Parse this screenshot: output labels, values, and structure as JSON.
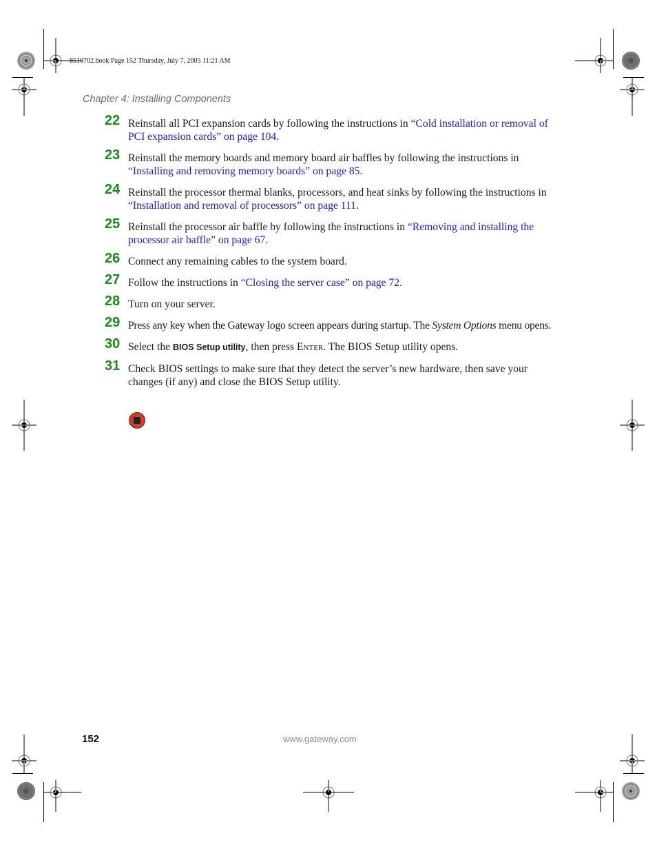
{
  "slug": "8510702.book  Page 152  Thursday, July 7, 2005  11:21 AM",
  "header": {
    "chapter": "Chapter 4: Installing Components"
  },
  "colors": {
    "step_number": "#1a8a1a",
    "link": "#1a1ad6",
    "stop_icon": "#d63a2a"
  },
  "steps": [
    {
      "num": "22",
      "pre": "Reinstall all PCI expansion cards by following the instructions in ",
      "link": "“Cold installation or removal of PCI expansion cards” on page 104",
      "post": "."
    },
    {
      "num": "23",
      "pre": "Reinstall the memory boards and memory board air baffles by following the instructions in ",
      "link": "“Installing and removing memory boards” on page 85",
      "post": "."
    },
    {
      "num": "24",
      "pre": "Reinstall the processor thermal blanks, processors, and heat sinks by following the instructions in ",
      "link": "“Installation and removal of processors” on page 111",
      "post": "."
    },
    {
      "num": "25",
      "pre": "Reinstall the processor air baffle by following the instructions in ",
      "link": "“Removing and installing the processor air baffle” on page 67",
      "post": "."
    },
    {
      "num": "26",
      "text": "Connect any remaining cables to the system board."
    },
    {
      "num": "27",
      "pre": "Follow the instructions in ",
      "link": "“Closing the server case” on page 72",
      "post": "."
    },
    {
      "num": "28",
      "text": "Turn on your server."
    },
    {
      "num": "29",
      "pre": "Press any key when the Gateway logo screen appears during startup. The ",
      "italic": "System Options",
      "post": " menu opens."
    },
    {
      "num": "30",
      "pre": "Select the ",
      "bold": "BIOS Setup utility",
      "mid": ", then press ",
      "key": "Enter",
      "post": ". The BIOS Setup utility opens."
    },
    {
      "num": "31",
      "text": "Check BIOS settings to make sure that they detect the server’s new hardware, then save your changes (if any) and close the BIOS Setup utility."
    }
  ],
  "footer": {
    "page_number": "152",
    "website": "www.gateway.com"
  }
}
